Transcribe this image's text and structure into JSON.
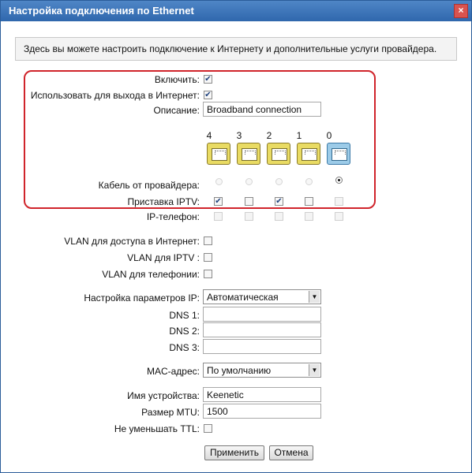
{
  "window": {
    "title": "Настройка подключения по Ethernet",
    "close": "×"
  },
  "info": "Здесь вы можете настроить подключение к Интернету и дополнительные услуги провайдера.",
  "fields": {
    "enable": {
      "label": "Включить:",
      "checked": true
    },
    "internet": {
      "label": "Использовать для выхода в Интернет:",
      "checked": true
    },
    "description": {
      "label": "Описание:",
      "value": "Broadband connection"
    }
  },
  "ports": {
    "numbers": [
      "4",
      "3",
      "2",
      "1",
      "0"
    ],
    "provider_label": "Кабель от провайдера:",
    "provider_selected": "0",
    "iptv_label": "Приставка IPTV:",
    "iptv_checked": [
      "4",
      "2"
    ],
    "ipphone_label": "IP-телефон:"
  },
  "vlan": {
    "internet": "VLAN для доступа в Интернет:",
    "iptv": "VLAN для IPTV :",
    "phone": "VLAN для телефонии:"
  },
  "ip": {
    "label": "Настройка параметров IP:",
    "value": "Автоматическая",
    "dns1": "DNS 1:",
    "dns2": "DNS 2:",
    "dns3": "DNS 3:"
  },
  "mac": {
    "label": "MAC-адрес:",
    "value": "По умолчанию"
  },
  "device": {
    "label": "Имя устройства:",
    "value": "Keenetic"
  },
  "mtu": {
    "label": "Размер MTU:",
    "value": "1500"
  },
  "ttl": {
    "label": "Не уменьшать TTL:"
  },
  "buttons": {
    "apply": "Применить",
    "cancel": "Отмена"
  },
  "colors": {
    "title_bar": "#3d74b9",
    "highlight_border": "#d0242b",
    "port_lan": "#e9db63",
    "port_wan": "#9ccbe8"
  }
}
